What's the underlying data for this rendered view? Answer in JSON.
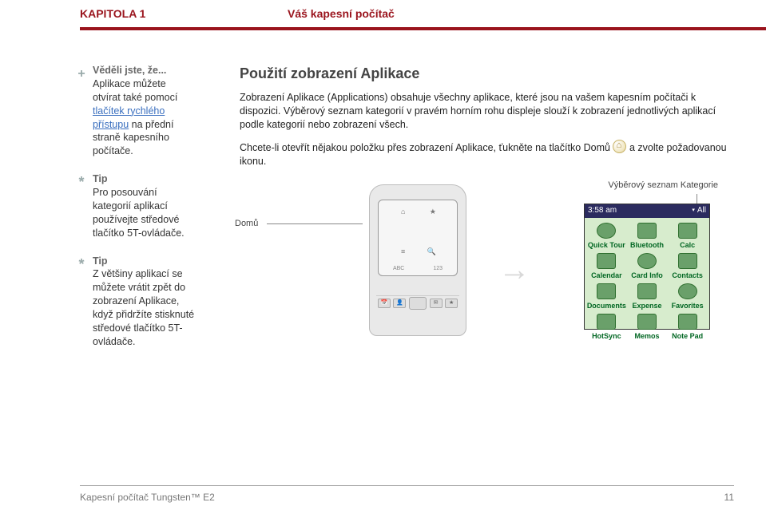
{
  "header": {
    "chapter": "KAPITOLA 1",
    "title": "Váš kapesní počítač"
  },
  "sidebar": {
    "didyouknow": {
      "heading": "Věděli jste, že...",
      "text_before_link1": "Aplikace můžete otvírat také pomocí ",
      "link1": "tlačítek rychlého přístupu",
      "text_after_link1": " na přední straně kapesního počítače."
    },
    "tip1": {
      "heading": "Tip",
      "text": "Pro posouvání kategorií aplikací používejte středové tlačítko 5T-ovládače."
    },
    "tip2": {
      "heading": "Tip",
      "text": "Z většiny aplikací se můžete vrátit zpět do zobrazení Aplikace, když přidržíte stisknuté středové tlačítko 5T-ovládače."
    }
  },
  "main": {
    "section_title": "Použití zobrazení Aplikace",
    "para1": "Zobrazení Aplikace (Applications) obsahuje všechny aplikace, které jsou na vašem kapesním počítači k dispozici. Výběrový seznam kategorií v pravém horním rohu displeje slouží k zobrazení jednotlivých aplikací podle kategorií nebo zobrazení všech.",
    "para2_a": "Chcete-li otevřít nějakou položku přes zobrazení Aplikace, ťukněte na tlačítko Domů",
    "para2_b": " a zvolte požadovanou ikonu."
  },
  "callouts": {
    "domu": "Domů",
    "kategorie": "Výběrový seznam Kategorie"
  },
  "device": {
    "graffiti_abc": "ABC",
    "graffiti_123": "123"
  },
  "arrow": "→",
  "palm_screen": {
    "time": "3:58 am",
    "category": "All",
    "apps": [
      {
        "label": "Quick Tour"
      },
      {
        "label": "Bluetooth"
      },
      {
        "label": "Calc"
      },
      {
        "label": "Calendar"
      },
      {
        "label": "Card Info"
      },
      {
        "label": "Contacts"
      },
      {
        "label": "Documents"
      },
      {
        "label": "Expense"
      },
      {
        "label": "Favorites"
      },
      {
        "label": "HotSync"
      },
      {
        "label": "Memos"
      },
      {
        "label": "Note Pad"
      }
    ]
  },
  "footer": {
    "left": "Kapesní počítač Tungsten™ E2",
    "page": "11"
  }
}
